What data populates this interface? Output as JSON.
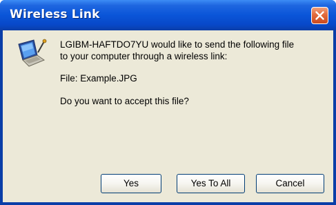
{
  "window": {
    "title": "Wireless Link"
  },
  "message": {
    "line1": "LGIBM-HAFTDO7YU would like to send the following file",
    "line2": "to your computer through a wireless link:",
    "file_label": "File: Example.JPG",
    "question": "Do you want to accept this file?"
  },
  "buttons": {
    "yes": "Yes",
    "yes_to_all": "Yes To All",
    "cancel": "Cancel"
  },
  "icons": {
    "title_close": "close-icon",
    "app": "wireless-laptop-icon"
  },
  "colors": {
    "titlebar": "#0a55d8",
    "client": "#ece9d8",
    "close_button": "#e26a3c",
    "button_border": "#003c74"
  }
}
